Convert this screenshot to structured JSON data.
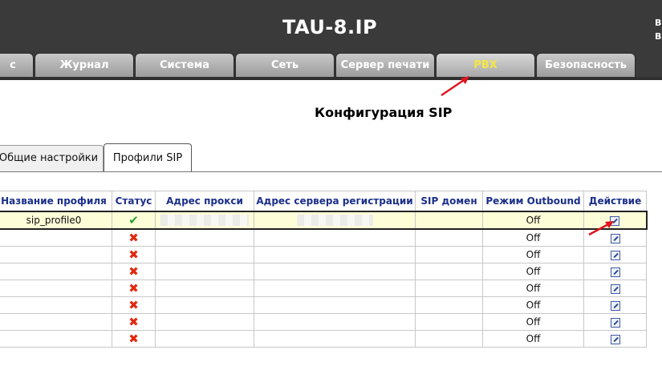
{
  "header": {
    "title": "TAU-8.IP",
    "right_text_line1": "В",
    "right_text_line2": "В"
  },
  "tabs": [
    {
      "label": "с",
      "active": false
    },
    {
      "label": "Журнал",
      "active": false
    },
    {
      "label": "Система",
      "active": false
    },
    {
      "label": "Сеть",
      "active": false
    },
    {
      "label": "Сервер печати",
      "active": false
    },
    {
      "label": "PBX",
      "active": true
    },
    {
      "label": "Безопасность",
      "active": false
    }
  ],
  "page": {
    "section_title": "Конфигурация SIP"
  },
  "subtabs": [
    {
      "label": "Общие настройки",
      "active": false
    },
    {
      "label": "Профили SIP",
      "active": true
    }
  ],
  "table": {
    "columns": [
      "Название профиля",
      "Статус",
      "Адрес прокси",
      "Адрес сервера регистрации",
      "SIP домен",
      "Режим Outbound",
      "Действие"
    ],
    "rows": [
      {
        "name": "sip_profile0",
        "status": "✔",
        "proxy": "",
        "registrar": "",
        "domain": "",
        "outbound": "Off",
        "selected": true
      },
      {
        "name": "",
        "status": "✖",
        "proxy": "",
        "registrar": "",
        "domain": "",
        "outbound": "Off",
        "selected": false
      },
      {
        "name": "",
        "status": "✖",
        "proxy": "",
        "registrar": "",
        "domain": "",
        "outbound": "Off",
        "selected": false
      },
      {
        "name": "",
        "status": "✖",
        "proxy": "",
        "registrar": "",
        "domain": "",
        "outbound": "Off",
        "selected": false
      },
      {
        "name": "",
        "status": "✖",
        "proxy": "",
        "registrar": "",
        "domain": "",
        "outbound": "Off",
        "selected": false
      },
      {
        "name": "",
        "status": "✖",
        "proxy": "",
        "registrar": "",
        "domain": "",
        "outbound": "Off",
        "selected": false
      },
      {
        "name": "",
        "status": "✖",
        "proxy": "",
        "registrar": "",
        "domain": "",
        "outbound": "Off",
        "selected": false
      },
      {
        "name": "",
        "status": "✖",
        "proxy": "",
        "registrar": "",
        "domain": "",
        "outbound": "Off",
        "selected": false
      }
    ]
  },
  "icons": {
    "status_enabled": "check-icon",
    "status_disabled": "cross-icon",
    "action": "edit-icon",
    "annotation": "red-arrow"
  },
  "colors": {
    "header_bg": "#3a3a3a",
    "active_tab_text": "#f5e642",
    "column_header_text": "#1b2f8a",
    "selected_row_bg": "#fdfdd8",
    "arrow": "#e0141e"
  }
}
